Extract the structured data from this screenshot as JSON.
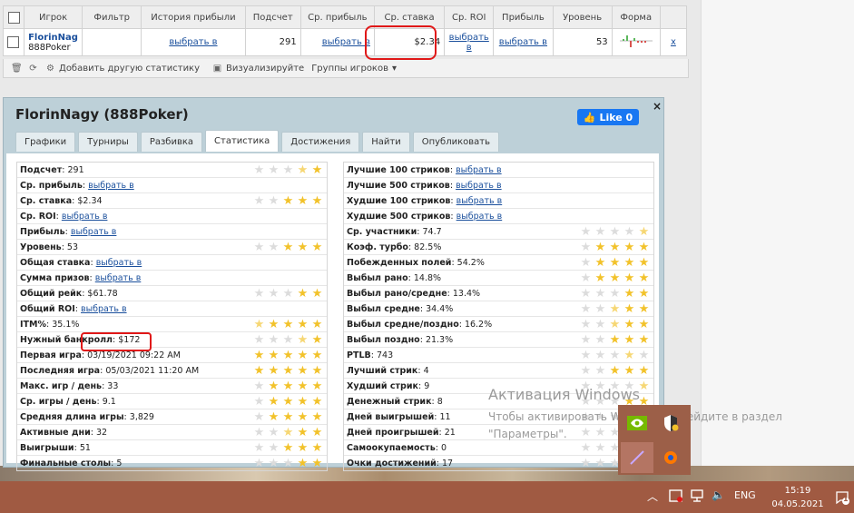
{
  "top_table": {
    "headers": [
      "Игрок",
      "Фильтр",
      "История прибыли",
      "Подсчет",
      "Ср. прибыль",
      "Ср. ставка",
      "Ср. ROI",
      "Прибыль",
      "Уровень",
      "Форма"
    ],
    "row": {
      "player": "FlorinNag",
      "network": "888Poker",
      "filter": "",
      "history": "выбрать в",
      "count": "291",
      "avg_profit": "выбрать в",
      "avg_stake": "$2.34",
      "avg_roi": "выбрать в",
      "profit": "выбрать в",
      "level": "53",
      "remove": "x"
    },
    "toolbar": {
      "add_stats": "Добавить другую статистику",
      "visualize": "Визуализируйте",
      "groups": "Группы игроков"
    }
  },
  "popup": {
    "title": "FlorinNagy (888Poker)",
    "like_label": "Like 0",
    "close": "×",
    "tabs": [
      "Графики",
      "Турниры",
      "Разбивка",
      "Статистика",
      "Достижения",
      "Найти",
      "Опубликовать"
    ],
    "active_tab": "Статистика",
    "left_stats": [
      {
        "label": "Подсчет",
        "value": "291",
        "link": false,
        "stars": [
          0,
          0,
          0,
          0.5,
          1
        ]
      },
      {
        "label": "Ср. прибыль",
        "value": "выбрать в",
        "link": true,
        "stars": null
      },
      {
        "label": "Ср. ставка",
        "value": "$2.34",
        "link": false,
        "stars": [
          0,
          0,
          1,
          1,
          1
        ]
      },
      {
        "label": "Ср. ROI",
        "value": "выбрать в",
        "link": true,
        "stars": null
      },
      {
        "label": "Прибыль",
        "value": "выбрать в",
        "link": true,
        "stars": null
      },
      {
        "label": "Уровень",
        "value": "53",
        "link": false,
        "stars": [
          0,
          0,
          1,
          1,
          1
        ]
      },
      {
        "label": "Общая ставка",
        "value": "выбрать в",
        "link": true,
        "stars": null
      },
      {
        "label": "Сумма призов",
        "value": "выбрать в",
        "link": true,
        "stars": null
      },
      {
        "label": "Общий рейк",
        "value": "$61.78",
        "link": false,
        "stars": [
          0,
          0,
          0,
          1,
          1
        ]
      },
      {
        "label": "Общий ROI",
        "value": "выбрать в",
        "link": true,
        "stars": null
      },
      {
        "label": "ITM%",
        "value": "35.1%",
        "link": false,
        "stars": [
          0.5,
          1,
          1,
          1,
          1
        ]
      },
      {
        "label": "Нужный банкролл",
        "value": "$172",
        "link": false,
        "stars": [
          0,
          0,
          0,
          0.5,
          1
        ]
      },
      {
        "label": "Первая игра",
        "value": "03/19/2021 09:22 AM",
        "link": false,
        "stars": [
          1,
          1,
          1,
          1,
          1
        ]
      },
      {
        "label": "Последняя игра",
        "value": "05/03/2021 11:20 AM",
        "link": false,
        "stars": [
          1,
          1,
          1,
          1,
          1
        ]
      },
      {
        "label": "Макс. игр / день",
        "value": "33",
        "link": false,
        "stars": [
          0,
          1,
          1,
          1,
          1
        ]
      },
      {
        "label": "Ср. игры / день",
        "value": "9.1",
        "link": false,
        "stars": [
          0,
          1,
          1,
          1,
          1
        ]
      },
      {
        "label": "Средняя длина игры",
        "value": "3,829",
        "link": false,
        "stars": [
          0,
          1,
          1,
          1,
          1
        ]
      },
      {
        "label": "Активные дни",
        "value": "32",
        "link": false,
        "stars": [
          0,
          0,
          0.5,
          1,
          1
        ]
      },
      {
        "label": "Выигрыши",
        "value": "51",
        "link": false,
        "stars": [
          0,
          0,
          1,
          1,
          1
        ]
      },
      {
        "label": "Финальные столы",
        "value": "5",
        "link": false,
        "stars": [
          0,
          0,
          0,
          1,
          1
        ]
      }
    ],
    "right_stats": [
      {
        "label": "Лучшие 100 стриков",
        "value": "выбрать в",
        "link": true,
        "stars": null
      },
      {
        "label": "Лучшие 500 стриков",
        "value": "выбрать в",
        "link": true,
        "stars": null
      },
      {
        "label": "Худшие 100 стриков",
        "value": "выбрать в",
        "link": true,
        "stars": null
      },
      {
        "label": "Худшие 500 стриков",
        "value": "выбрать в",
        "link": true,
        "stars": null
      },
      {
        "label": "Ср. участники",
        "value": "74.7",
        "link": false,
        "stars": [
          0,
          0,
          0,
          0,
          0.5
        ]
      },
      {
        "label": "Коэф. турбо",
        "value": "82.5%",
        "link": false,
        "stars": [
          0,
          1,
          1,
          1,
          1
        ]
      },
      {
        "label": "Побежденных полей",
        "value": "54.2%",
        "link": false,
        "stars": [
          0,
          1,
          1,
          1,
          1
        ]
      },
      {
        "label": "Выбыл рано",
        "value": "14.8%",
        "link": false,
        "stars": [
          0,
          1,
          1,
          1,
          1
        ]
      },
      {
        "label": "Выбыл рано/средне",
        "value": "13.4%",
        "link": false,
        "stars": [
          0,
          0,
          0,
          1,
          1
        ]
      },
      {
        "label": "Выбыл средне",
        "value": "34.4%",
        "link": false,
        "stars": [
          0,
          0,
          0.5,
          1,
          1
        ]
      },
      {
        "label": "Выбыл средне/поздно",
        "value": "16.2%",
        "link": false,
        "stars": [
          0,
          0,
          0.5,
          1,
          1
        ]
      },
      {
        "label": "Выбыл поздно",
        "value": "21.3%",
        "link": false,
        "stars": [
          0,
          0,
          1,
          1,
          1
        ]
      },
      {
        "label": "PTLB",
        "value": "743",
        "link": false,
        "stars": [
          0,
          0,
          0,
          0.5,
          0
        ]
      },
      {
        "label": "Лучший стрик",
        "value": "4",
        "link": false,
        "stars": [
          0,
          0,
          1,
          1,
          1
        ]
      },
      {
        "label": "Худший стрик",
        "value": "9",
        "link": false,
        "stars": [
          0,
          0,
          0,
          0,
          0.5
        ]
      },
      {
        "label": "Денежный стрик",
        "value": "8",
        "link": false,
        "stars": [
          0,
          0,
          0,
          1,
          1
        ]
      },
      {
        "label": "Дней выигрышей",
        "value": "11",
        "link": false,
        "stars": [
          0,
          0,
          0,
          0,
          0
        ]
      },
      {
        "label": "Дней проигрышей",
        "value": "21",
        "link": false,
        "stars": [
          0,
          0,
          0,
          0,
          0
        ]
      },
      {
        "label": "Самоокупаемость",
        "value": "0",
        "link": false,
        "stars": [
          0,
          0,
          0,
          0,
          0
        ]
      },
      {
        "label": "Очки достижений",
        "value": "17",
        "link": false,
        "stars": [
          0,
          0,
          0,
          0,
          0
        ]
      }
    ]
  },
  "watermark": {
    "title": "Активация Windows",
    "line1": "Чтобы активировать Windows, перейдите в раздел",
    "line2": "\"Параметры\"."
  },
  "taskbar": {
    "lang": "ENG",
    "time": "15:19",
    "date": "04.05.2021",
    "notifications": "1"
  },
  "colors": {
    "link": "#1a4f9c",
    "popup_bg": "#bdd0d8",
    "taskbar": "#a05a42",
    "star": "#f2c22a",
    "annotation": "#e01818"
  }
}
